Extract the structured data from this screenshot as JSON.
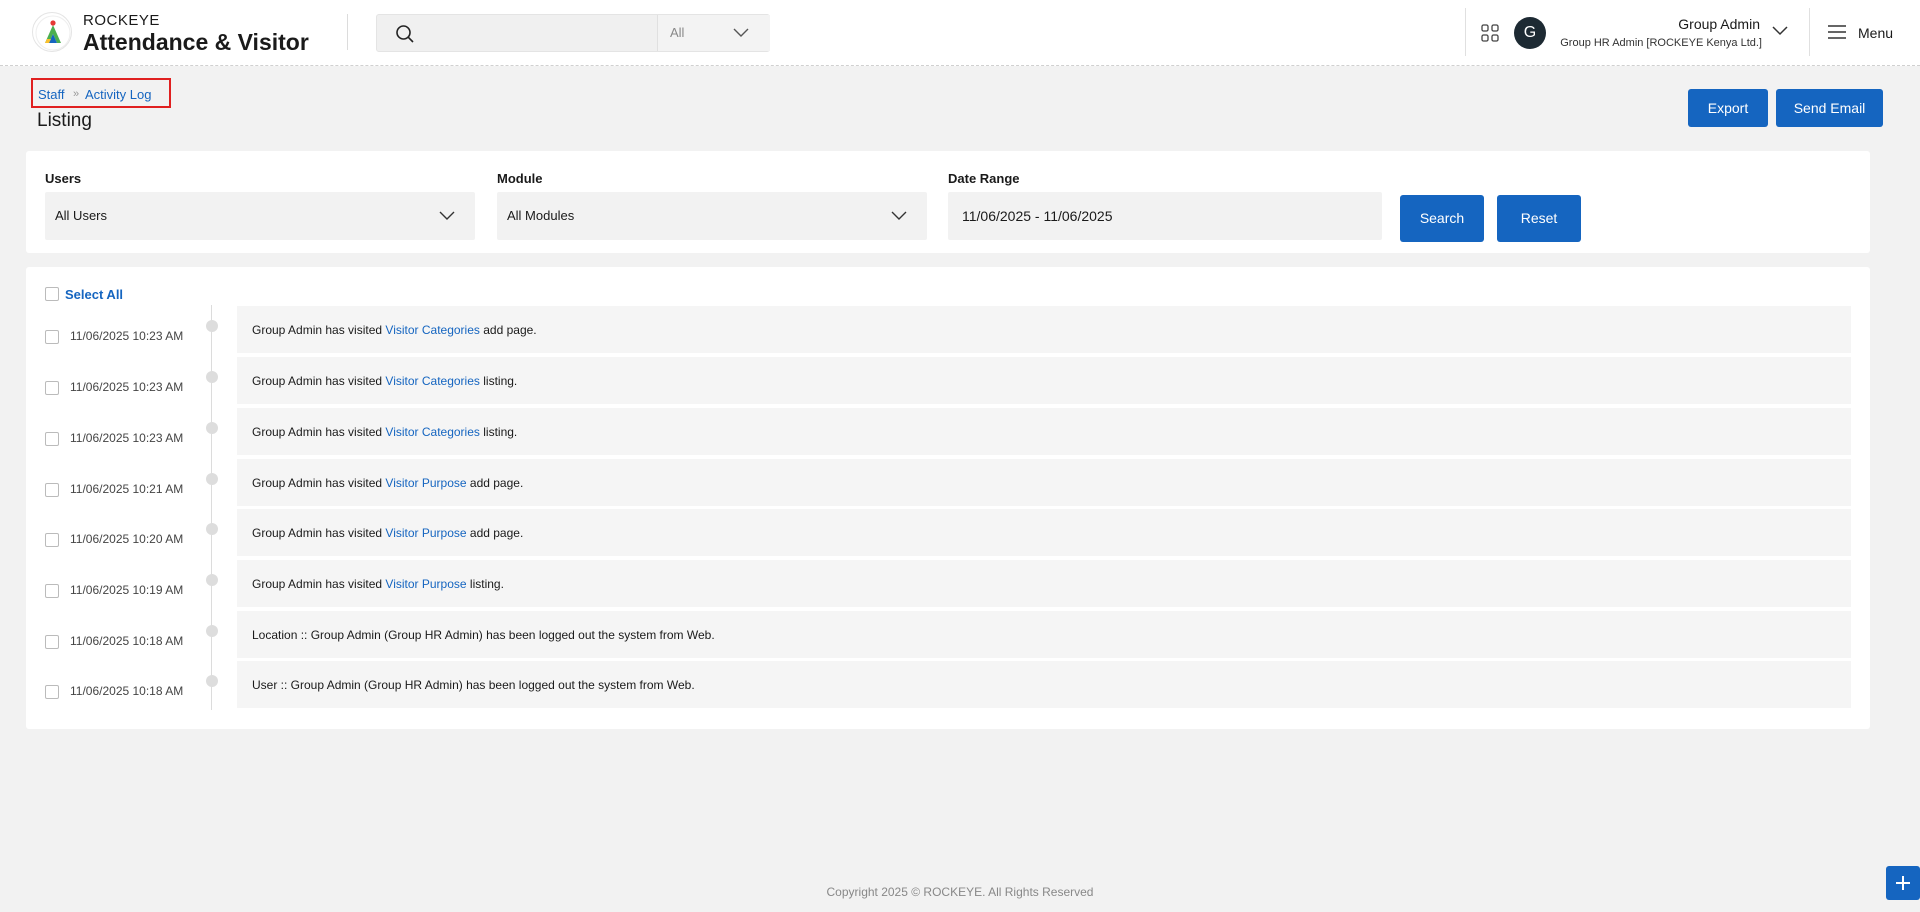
{
  "brand": {
    "top": "ROCKEYE",
    "main": "Attendance & Visitor"
  },
  "search": {
    "placeholder": "",
    "scope": "All"
  },
  "user": {
    "initial": "G",
    "name": "Group Admin",
    "role": "Group HR Admin [ROCKEYE Kenya Ltd.]"
  },
  "menu": {
    "label": "Menu"
  },
  "breadcrumb": {
    "items": [
      "Staff",
      "Activity Log"
    ]
  },
  "page": {
    "title": "Listing"
  },
  "actions": {
    "export": "Export",
    "send_email": "Send Email"
  },
  "filters": {
    "users_label": "Users",
    "users_value": "All Users",
    "module_label": "Module",
    "module_value": "All Modules",
    "date_label": "Date Range",
    "date_value": "11/06/2025 - 11/06/2025",
    "search": "Search",
    "reset": "Reset"
  },
  "log": {
    "select_all": "Select All",
    "entries": [
      {
        "time": "11/06/2025 10:23 AM",
        "pre": "Group Admin has visited ",
        "link": "Visitor Categories",
        "post": " add page."
      },
      {
        "time": "11/06/2025 10:23 AM",
        "pre": "Group Admin has visited ",
        "link": "Visitor Categories",
        "post": " listing."
      },
      {
        "time": "11/06/2025 10:23 AM",
        "pre": "Group Admin has visited ",
        "link": "Visitor Categories",
        "post": " listing."
      },
      {
        "time": "11/06/2025 10:21 AM",
        "pre": "Group Admin has visited ",
        "link": "Visitor Purpose",
        "post": " add page."
      },
      {
        "time": "11/06/2025 10:20 AM",
        "pre": "Group Admin has visited ",
        "link": "Visitor Purpose",
        "post": " add page."
      },
      {
        "time": "11/06/2025 10:19 AM",
        "pre": "Group Admin has visited ",
        "link": "Visitor Purpose",
        "post": " listing."
      },
      {
        "time": "11/06/2025 10:18 AM",
        "pre": "Location :: Group Admin (Group HR Admin) has been logged out the system from Web.",
        "link": "",
        "post": ""
      },
      {
        "time": "11/06/2025 10:18 AM",
        "pre": "User :: Group Admin (Group HR Admin) has been logged out the system from Web.",
        "link": "",
        "post": ""
      }
    ]
  },
  "footer": {
    "text": "Copyright 2025 © ROCKEYE. All Rights Reserved"
  },
  "colors": {
    "accent": "#1565c0",
    "highlight": "#e02020",
    "avatar": "#1d2a33"
  }
}
